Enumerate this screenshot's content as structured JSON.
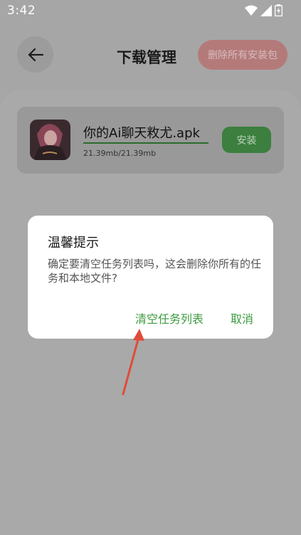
{
  "status_bar": {
    "time": "3:42",
    "icons": [
      "wifi-icon",
      "signal-icon",
      "battery-icon"
    ]
  },
  "header": {
    "back_icon": "arrow-left-icon",
    "title": "下载管理",
    "delete_all_label": "删除所有安装包"
  },
  "download_item": {
    "file_name": "你的Ai聊天敉尤.apk",
    "size_text": "21.39mb/21.39mb",
    "progress": 1.0,
    "install_label": "安装"
  },
  "dialog": {
    "title": "温馨提示",
    "message": "确定要清空任务列表吗，这会删除你所有的任务和本地文件?",
    "confirm_label": "清空任务列表",
    "cancel_label": "取消"
  },
  "colors": {
    "accent_green": "#3c9a3f",
    "delete_red": "#b47a7a",
    "annotation_arrow": "#e04b3a"
  }
}
